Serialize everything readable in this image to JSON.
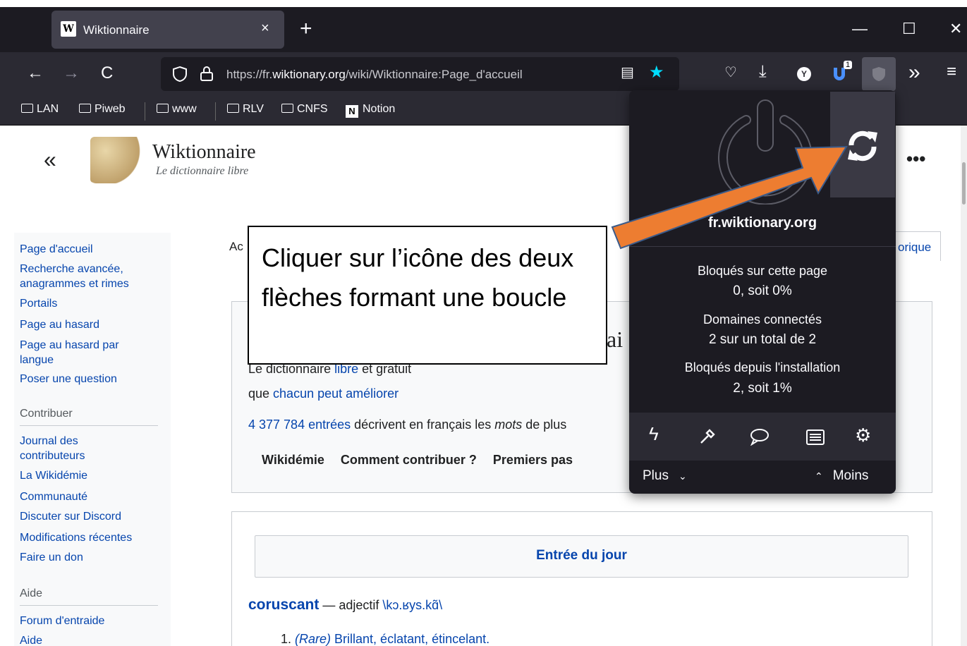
{
  "tab": {
    "favicon": "W",
    "title": "Wiktionnaire",
    "close": "×",
    "new": "+"
  },
  "window": {
    "minimize": "—",
    "maximize": "☐",
    "close": "✕"
  },
  "nav": {
    "back": "←",
    "forward": "→",
    "reload": "C",
    "url_prefix": "https://fr.",
    "url_domain": "wiktionary.org",
    "url_path": "/wiki/Wiktionnaire:Page_d'accueil",
    "reader": "▤",
    "bookmark_star": "★",
    "pocket": "♡",
    "download": "⤓",
    "extensions_more": "»",
    "menu": "≡",
    "ext_badge": "1"
  },
  "bookmarks": [
    {
      "label": "LAN"
    },
    {
      "label": "Piweb"
    },
    {
      "label": "www"
    },
    {
      "label": "RLV"
    },
    {
      "label": "CNFS"
    },
    {
      "label": "Notion"
    }
  ],
  "site": {
    "collapse": "«",
    "name": "Wiktionnaire",
    "tagline": "Le dictionnaire libre",
    "more": "•••"
  },
  "sidebar": {
    "nav": [
      "Page d'accueil",
      "Recherche avancée, anagrammes et rimes",
      "Portails",
      "Page au hasard",
      "Page au hasard par langue",
      "Poser une question"
    ],
    "contrib_heading": "Contribuer",
    "contrib": [
      "Journal des contributeurs",
      "La Wikidémie",
      "Communauté",
      "Discuter sur Discord",
      "Modifications récentes",
      "Faire un don"
    ],
    "help_heading": "Aide",
    "help": [
      "Forum d'entraide",
      "Aide"
    ]
  },
  "main": {
    "tab_left": "Ac",
    "tab_right": "orique",
    "title_fragment": "ai",
    "line1_a": "Le dictionnaire ",
    "line1_link": "libre",
    "line1_b": " et gratuit",
    "line2_a": "que ",
    "line2_link": "chacun peut améliorer",
    "line3_link": "4 377 784 entrées",
    "line3_a": " décrivent en français les ",
    "line3_em": "mots",
    "line3_b": " de plus",
    "links": [
      "Wikidémie",
      "Comment contribuer ?",
      "Premiers pas"
    ],
    "entry_title": "Entrée du jour",
    "word": "coruscant",
    "word_dash": " — adjectif ",
    "word_pron": "\\kɔ.ʁys.kɑ̃\\",
    "def_num": "1. ",
    "def_tag": "(Rare)",
    "def_text": " Brillant, éclatant, étincelant."
  },
  "callout": {
    "text": "Cliquer sur l’icône des deux flèches formant une boucle"
  },
  "popup": {
    "domain": "fr.wiktionary.org",
    "blocked_label": "Bloqués sur cette page",
    "blocked_value": "0, soit 0%",
    "domains_label": "Domaines connectés",
    "domains_value": "2 sur un total de 2",
    "since_label": "Bloqués depuis l'installation",
    "since_value": "2, soit 1%",
    "more": "Plus",
    "less": "Moins"
  },
  "colors": {
    "arrow": "#ed7d31",
    "popup_bg": "#1c1b22",
    "link": "#0645ad"
  }
}
